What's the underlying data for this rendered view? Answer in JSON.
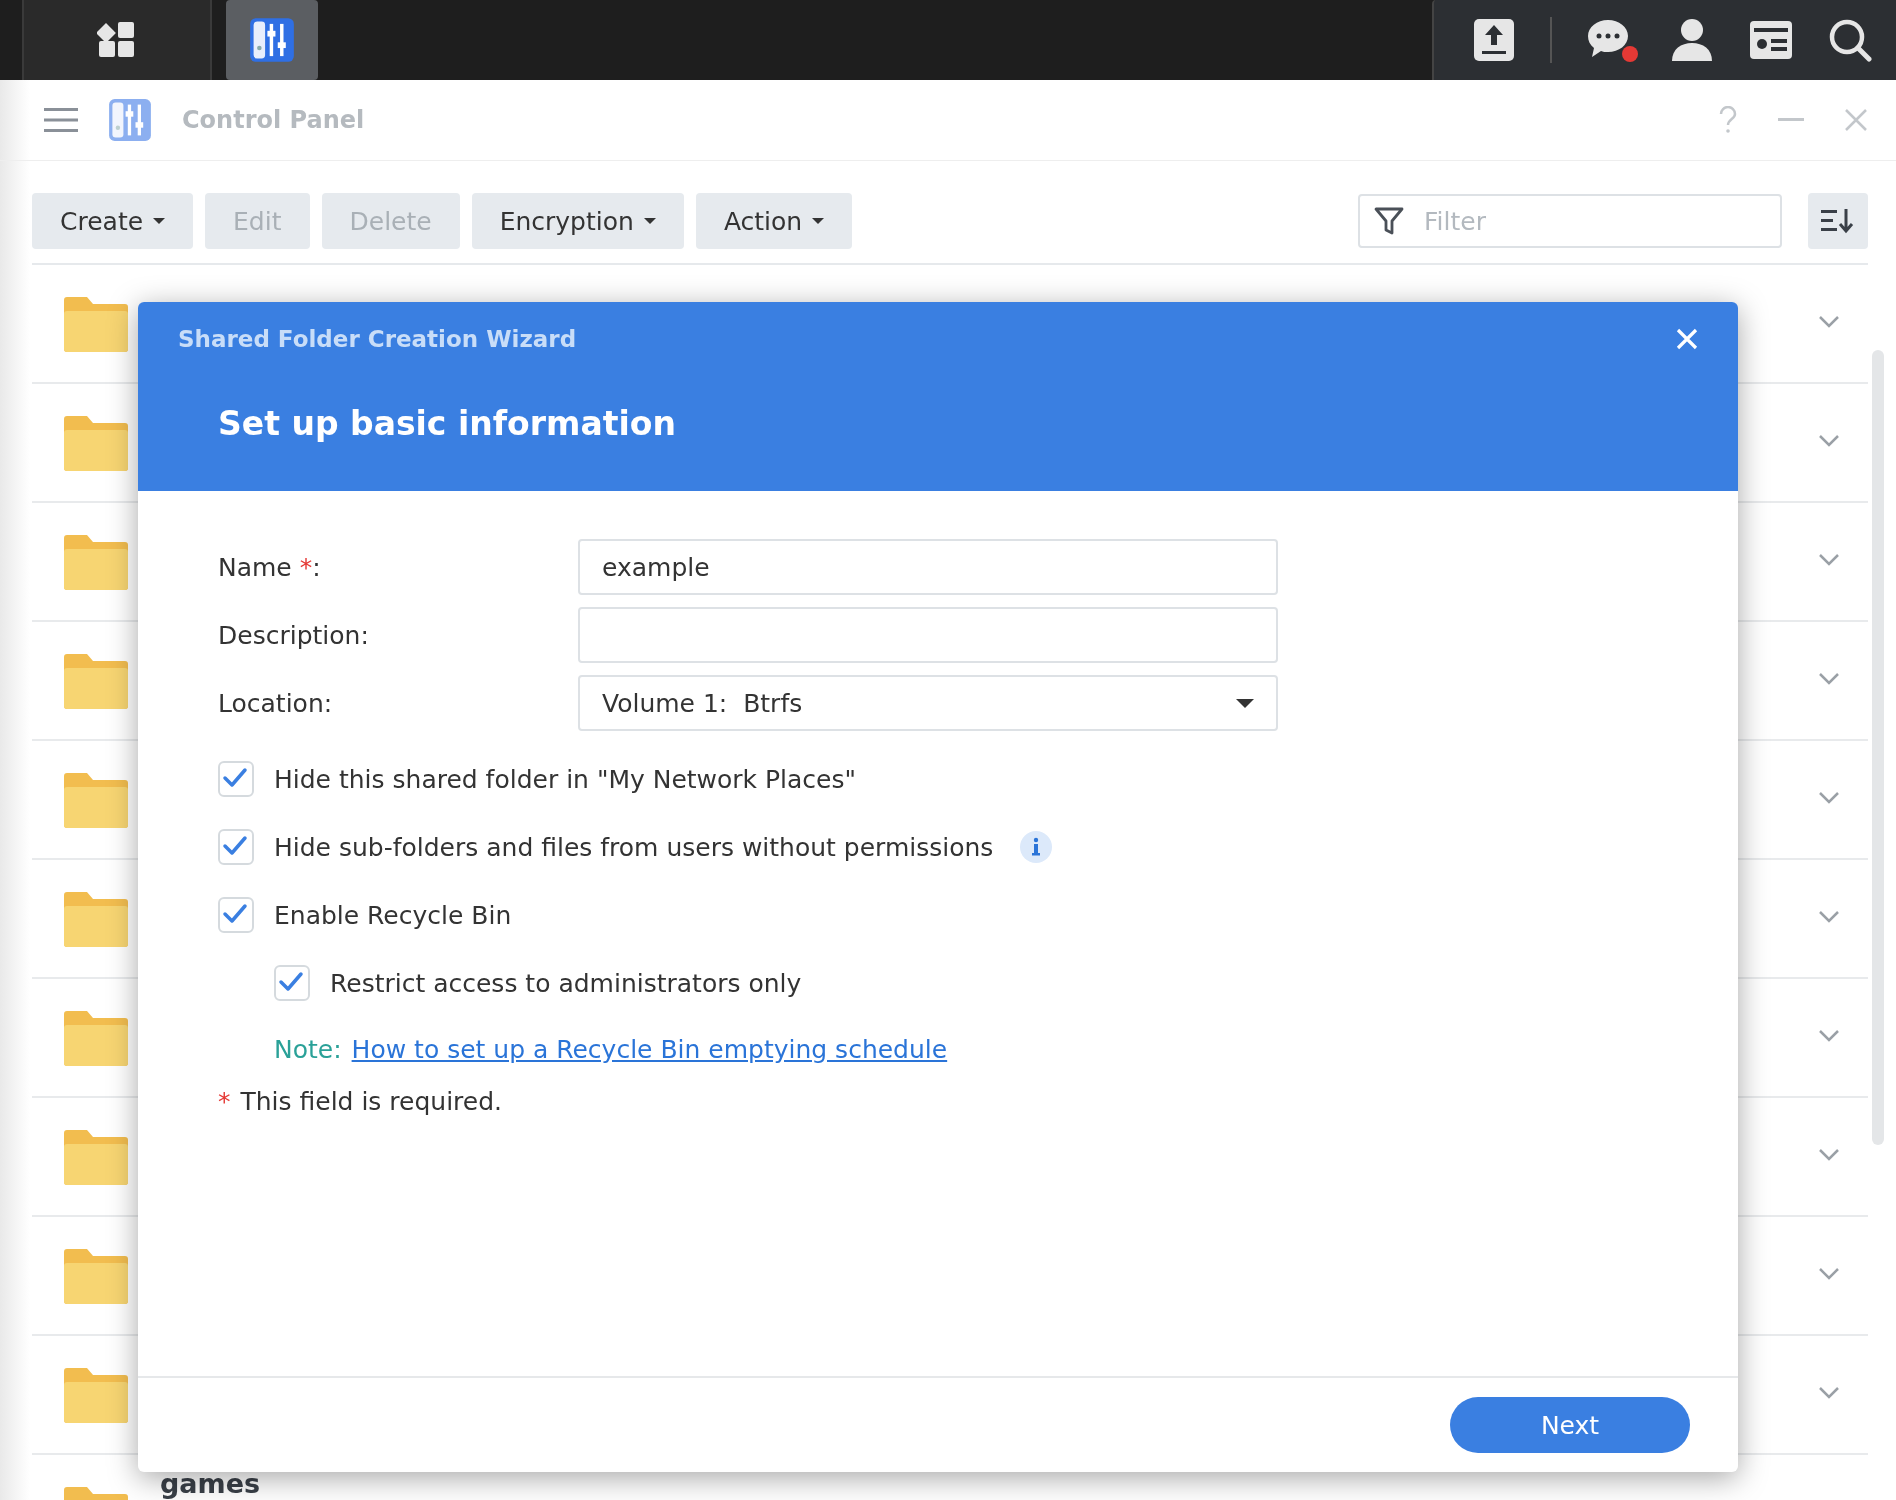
{
  "taskbar": {
    "buttons": [
      {
        "kind": "main-menu",
        "selected": false
      },
      {
        "kind": "control-panel",
        "selected": true
      }
    ],
    "tray": [
      {
        "kind": "upload",
        "notification": false
      },
      {
        "kind": "chat",
        "notification": true
      },
      {
        "kind": "user",
        "notification": false
      },
      {
        "kind": "widgets",
        "notification": false
      },
      {
        "kind": "search",
        "notification": false
      }
    ]
  },
  "window": {
    "title": "Control Panel"
  },
  "toolbar": {
    "buttons": [
      {
        "label": "Create",
        "dropdown": true,
        "disabled": false
      },
      {
        "label": "Edit",
        "dropdown": false,
        "disabled": true
      },
      {
        "label": "Delete",
        "dropdown": false,
        "disabled": true
      },
      {
        "label": "Encryption",
        "dropdown": true,
        "disabled": false
      },
      {
        "label": "Action",
        "dropdown": true,
        "disabled": false
      }
    ],
    "filter": {
      "placeholder": "Filter"
    }
  },
  "folders": [
    {
      "chevron": true
    },
    {
      "chevron": true
    },
    {
      "chevron": true
    },
    {
      "chevron": true
    },
    {
      "chevron": true
    },
    {
      "chevron": true
    },
    {
      "chevron": true
    },
    {
      "chevron": true
    },
    {
      "chevron": true
    },
    {
      "chevron": true
    },
    {
      "name": "games",
      "chevron": false
    }
  ],
  "dialog": {
    "title": "Shared Folder Creation Wizard",
    "heading": "Set up basic information",
    "fields": [
      {
        "kind": "text",
        "label": "Name",
        "mark": "*",
        "suffix": ":",
        "value": "example"
      },
      {
        "kind": "text",
        "label": "Description:"
      },
      {
        "kind": "select",
        "label": "Location:",
        "value": "Volume 1:  Btrfs"
      }
    ],
    "options": [
      {
        "label": "Hide this shared folder in \"My Network Places\"",
        "checked": true,
        "info": false
      },
      {
        "label": "Hide sub-folders and files from users without permissions",
        "checked": true,
        "info": true
      },
      {
        "label": "Enable Recycle Bin",
        "checked": true,
        "info": false,
        "children": [
          {
            "label": "Restrict access to administrators only",
            "checked": true,
            "info": false
          }
        ]
      }
    ],
    "note": {
      "prefix": "Note:",
      "link": "How to set up a Recycle Bin emptying schedule"
    },
    "required_note": {
      "mark": "*",
      "text": "This field is required."
    },
    "buttons": [
      {
        "label": "Next",
        "primary": true
      }
    ]
  }
}
